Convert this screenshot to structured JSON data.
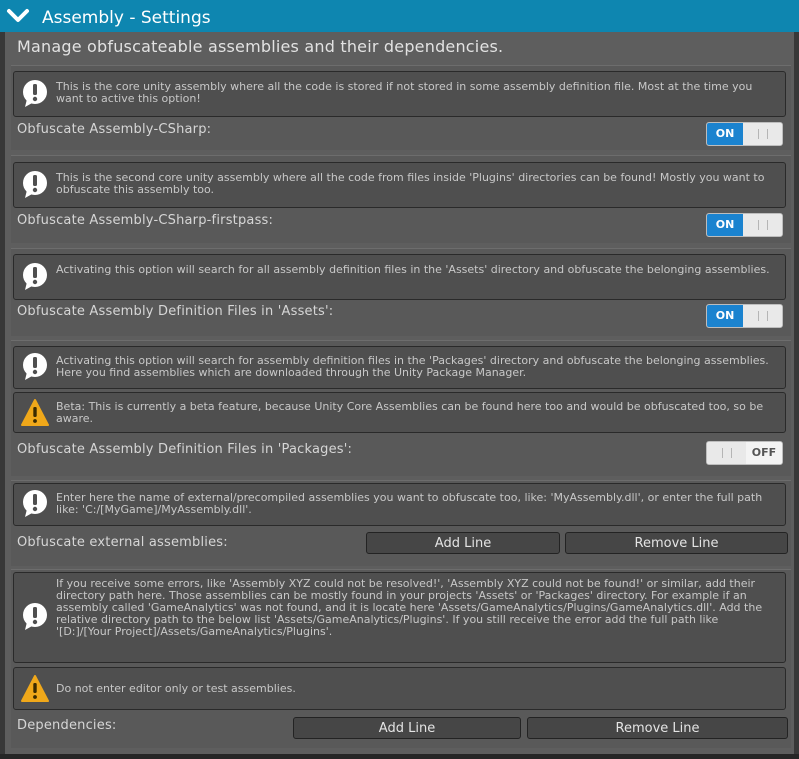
{
  "header": {
    "title": "Assembly - Settings",
    "expand_icon": "chevron-down-icon"
  },
  "subtitle": "Manage obfuscateable assemblies and their dependencies.",
  "sections": [
    {
      "help": "This is the core unity assembly where all the code is stored if not stored in some assembly definition file. Most at the time you want to active this option!",
      "label": "Obfuscate Assembly-CSharp:",
      "toggle": {
        "state": "ON"
      }
    },
    {
      "help": "This is the second core unity assembly where all the code from files inside 'Plugins' directories can be found! Mostly you want to obfuscate this assembly too.",
      "label": "Obfuscate Assembly-CSharp-firstpass:",
      "toggle": {
        "state": "ON"
      }
    },
    {
      "help": "Activating this option will search for all assembly definition files in the 'Assets' directory and obfuscate the belonging assemblies.",
      "label": "Obfuscate Assembly Definition Files in 'Assets':",
      "toggle": {
        "state": "ON"
      }
    },
    {
      "help": "Activating this option will search for assembly definition files in the 'Packages' directory and obfuscate the belonging assemblies. Here you find assemblies which are downloaded through the Unity Package Manager.",
      "warning": "Beta: This is currently a beta feature, because Unity Core Assemblies can be found here too and would be obfuscated too, so be aware.",
      "label": "Obfuscate Assembly Definition Files in 'Packages':",
      "toggle": {
        "state": "OFF"
      }
    },
    {
      "help": "Enter here the name of external/precompiled assemblies you want to obfuscate too, like: 'MyAssembly.dll', or enter the full path like: 'C:/[MyGame]/MyAssembly.dll'.",
      "label": "Obfuscate external assemblies:",
      "add_label": "Add Line",
      "remove_label": "Remove Line"
    },
    {
      "help": "If you receive some errors, like 'Assembly XYZ could not be resolved!', 'Assembly XYZ could not be found!' or similar, add their directory path here. Those assemblies can be mostly found in your projects 'Assets' or 'Packages' directory. For example if an assembly called 'GameAnalytics' was not found, and it is locate here 'Assets/GameAnalytics/Plugins/GameAnalytics.dll'. Add the relative directory path to the below list 'Assets/GameAnalytics/Plugins'. If you still receive the error add the full path like '[D:]/[Your Project]/Assets/GameAnalytics/Plugins'.",
      "warning": "Do not enter editor only or test assemblies.",
      "label": "Dependencies:",
      "add_label": "Add Line",
      "remove_label": "Remove Line"
    }
  ],
  "icons": {
    "info": "info-icon",
    "warning": "warning-icon"
  },
  "colors": {
    "accent": "#0e86b0",
    "toggle_on": "#1b83cf",
    "warning": "#f0a81a"
  }
}
